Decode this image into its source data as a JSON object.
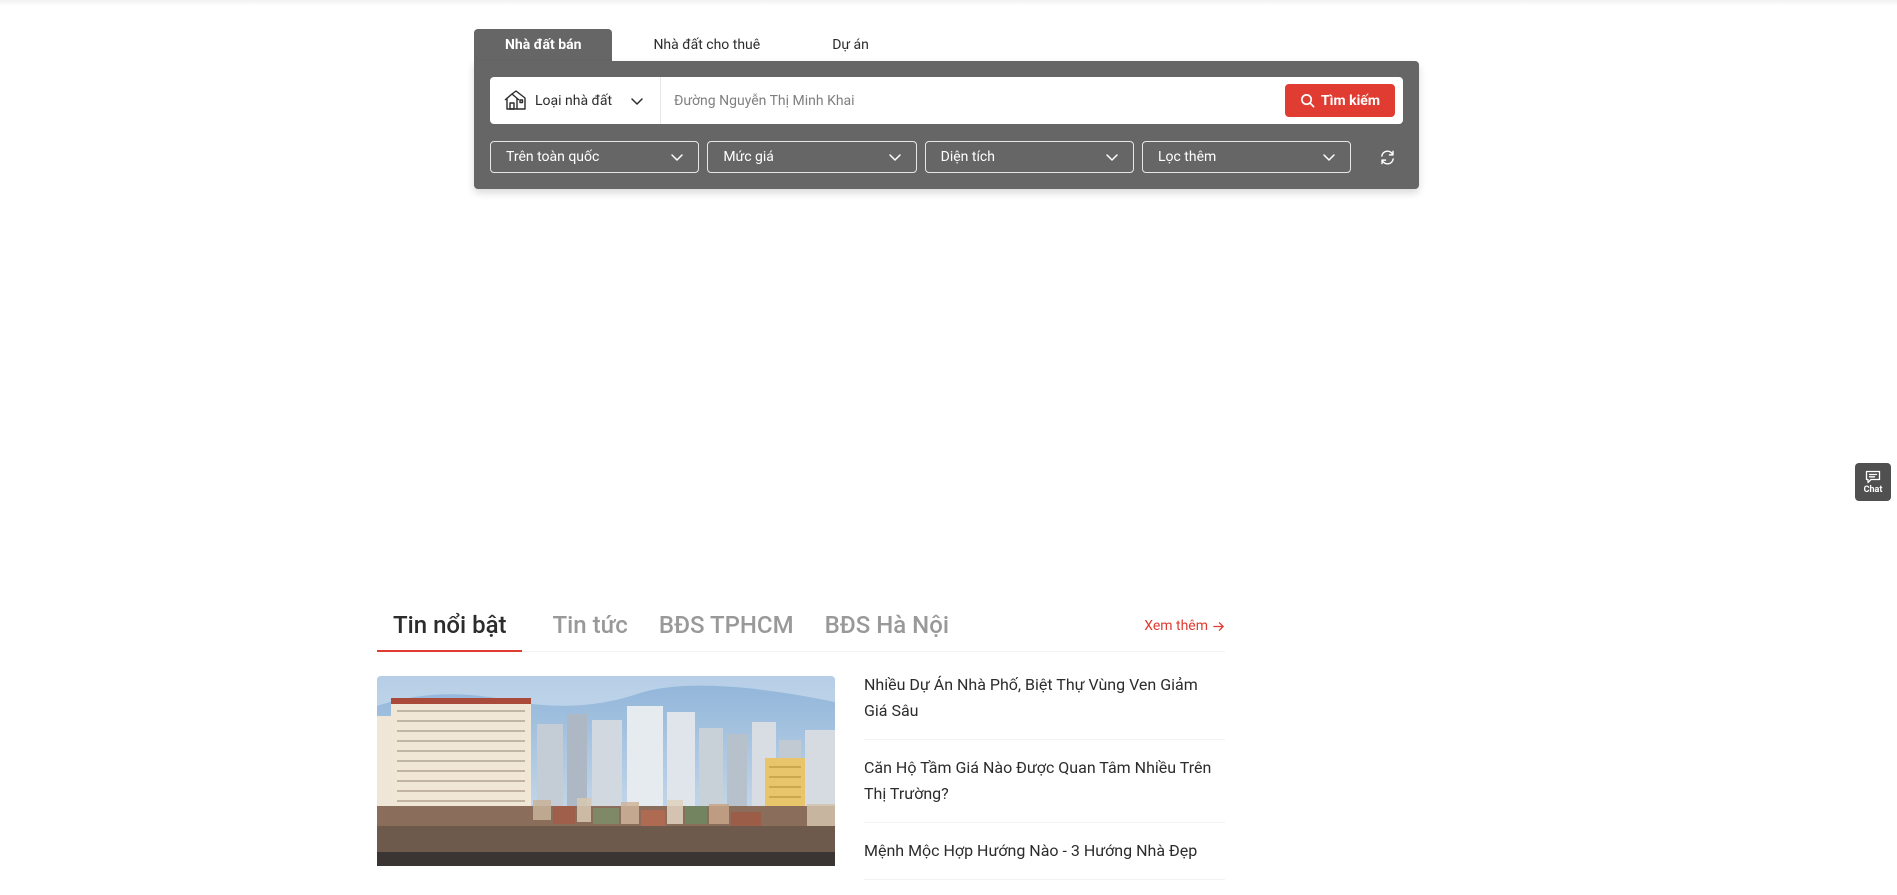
{
  "search": {
    "tabs": [
      {
        "label": "Nhà đất bán",
        "active": true
      },
      {
        "label": "Nhà đất cho thuê",
        "active": false
      },
      {
        "label": "Dự án",
        "active": false
      }
    ],
    "property_type_label": "Loại nhà đất",
    "keyword_placeholder": "Đường Nguyễn Thị Minh Khai",
    "search_button_label": "Tìm kiếm",
    "filters": [
      {
        "label": "Trên toàn quốc"
      },
      {
        "label": "Mức giá"
      },
      {
        "label": "Diện tích"
      },
      {
        "label": "Lọc thêm"
      }
    ],
    "colors": {
      "panel": "#666666",
      "accent": "#e03c31"
    }
  },
  "chat": {
    "label": "Chat",
    "icon": "chat-bubble-icon"
  },
  "news": {
    "tabs": [
      {
        "label": "Tin nổi bật",
        "active": true
      },
      {
        "label": "Tin tức",
        "active": false
      },
      {
        "label": "BĐS TPHCM",
        "active": false
      },
      {
        "label": "BĐS Hà Nội",
        "active": false
      }
    ],
    "more_label": "Xem thêm",
    "articles": [
      {
        "title": "Nhiều Dự Án Nhà Phố, Biệt Thự Vùng Ven Giảm Giá Sâu"
      },
      {
        "title": "Căn Hộ Tầm Giá Nào Được Quan Tâm Nhiều Trên Thị Trường?"
      },
      {
        "title": "Mệnh Mộc Hợp Hướng Nào - 3 Hướng Nhà Đẹp"
      }
    ]
  }
}
